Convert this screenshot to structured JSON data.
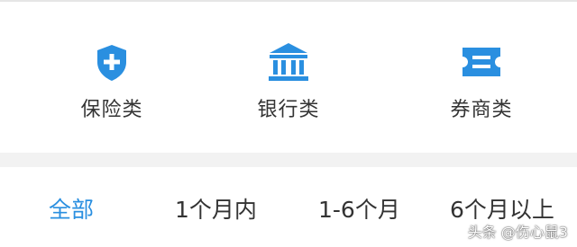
{
  "colors": {
    "accent": "#2a8fe0",
    "text": "#333333",
    "separator": "#f2f2f2"
  },
  "categories": [
    {
      "label": "保险类",
      "icon": "shield-plus-icon"
    },
    {
      "label": "银行类",
      "icon": "bank-icon"
    },
    {
      "label": "券商类",
      "icon": "ticket-icon"
    }
  ],
  "filters": {
    "tabs": [
      "全部",
      "1个月内",
      "1-6个月",
      "6个月以上"
    ],
    "active": "全部"
  },
  "watermark": "头条 @伤心鼠3"
}
